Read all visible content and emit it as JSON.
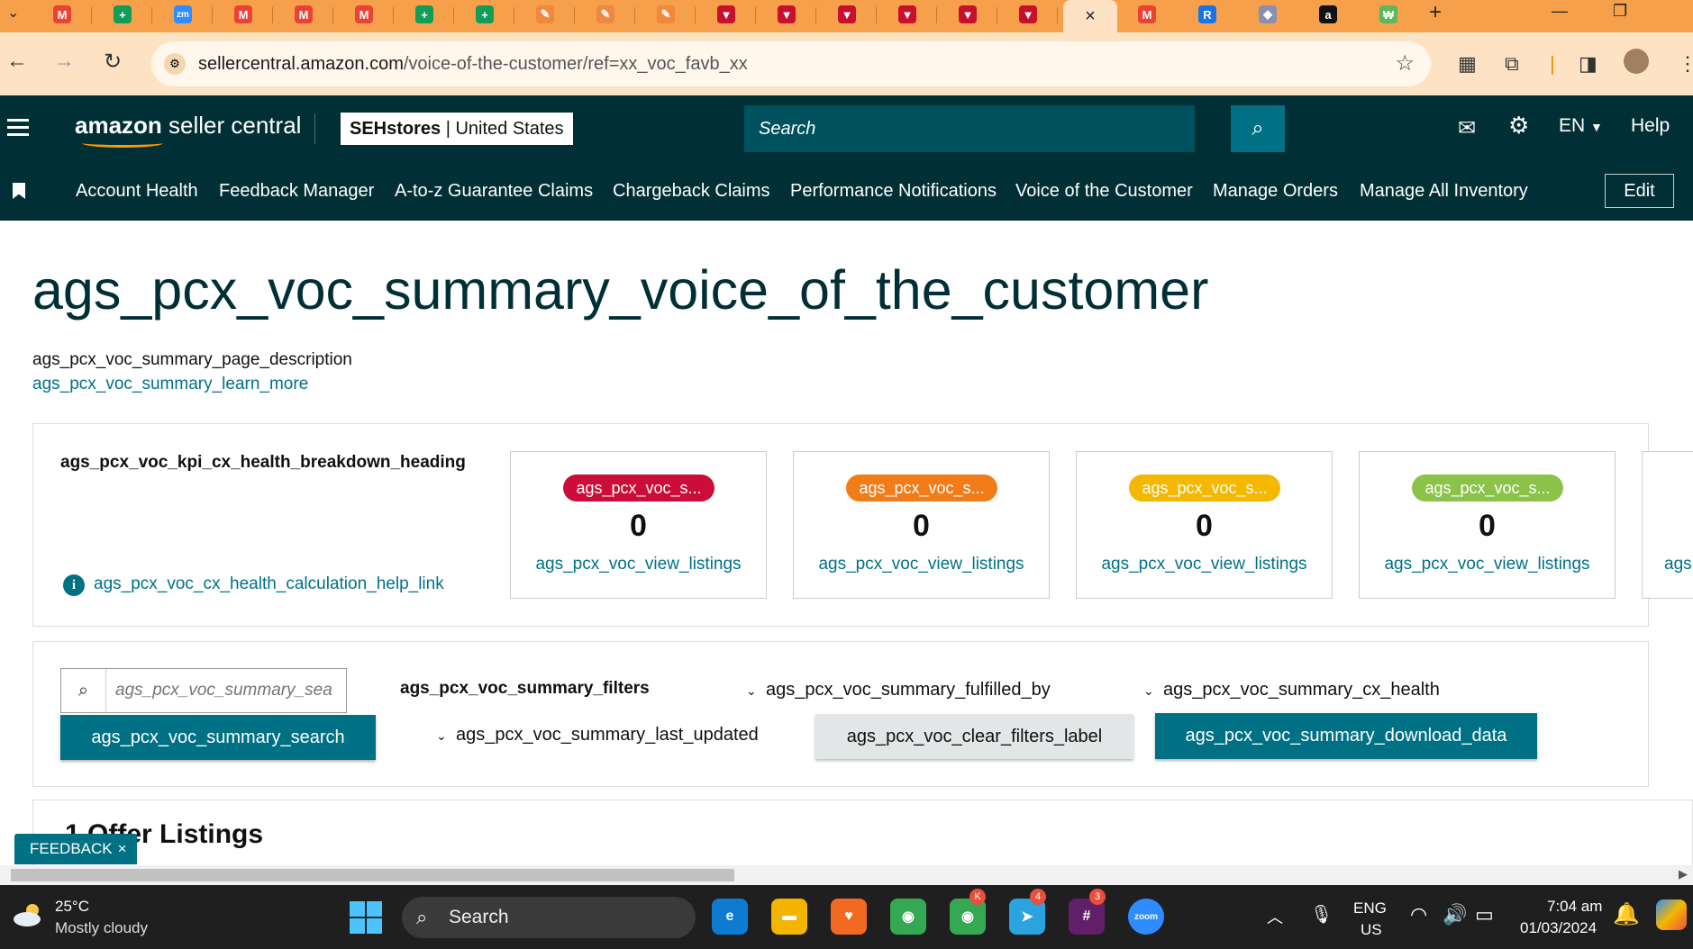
{
  "browser": {
    "tabs": [
      {
        "icon": "gmail-icon",
        "color": "#ea4335",
        "glyph": "M"
      },
      {
        "icon": "sheets-icon",
        "color": "#0f9d58",
        "glyph": "+"
      },
      {
        "icon": "zoom-icon",
        "color": "#2d8cff",
        "glyph": "zm"
      },
      {
        "icon": "gmail-icon",
        "color": "#ea4335",
        "glyph": "M"
      },
      {
        "icon": "gmail-icon",
        "color": "#ea4335",
        "glyph": "M"
      },
      {
        "icon": "gmail-icon",
        "color": "#ea4335",
        "glyph": "M"
      },
      {
        "icon": "sheets-icon",
        "color": "#0f9d58",
        "glyph": "+"
      },
      {
        "icon": "sheets-icon",
        "color": "#0f9d58",
        "glyph": "+"
      },
      {
        "icon": "edit-icon",
        "color": "#f0883e",
        "glyph": "✎"
      },
      {
        "icon": "edit-icon",
        "color": "#f0883e",
        "glyph": "✎"
      },
      {
        "icon": "edit-icon",
        "color": "#f0883e",
        "glyph": "✎"
      },
      {
        "icon": "vivaldi-icon",
        "color": "#c8102e",
        "glyph": "▼"
      },
      {
        "icon": "vivaldi-icon",
        "color": "#c8102e",
        "glyph": "▼"
      },
      {
        "icon": "vivaldi-icon",
        "color": "#c8102e",
        "glyph": "▼"
      },
      {
        "icon": "vivaldi-icon",
        "color": "#c8102e",
        "glyph": "▼"
      },
      {
        "icon": "vivaldi-icon",
        "color": "#c8102e",
        "glyph": "▼"
      },
      {
        "icon": "vivaldi-icon",
        "color": "#c8102e",
        "glyph": "▼"
      }
    ],
    "active_tab_close": "×",
    "after_tabs": [
      {
        "icon": "gmail-icon",
        "color": "#ea4335",
        "glyph": "M"
      },
      {
        "icon": "r-app-icon",
        "color": "#1a73e8",
        "glyph": "R"
      },
      {
        "icon": "puzzle-icon",
        "color": "#8a8fb0",
        "glyph": "◆"
      },
      {
        "icon": "amazon-icon",
        "color": "#111111",
        "glyph": "a"
      },
      {
        "icon": "green-app-icon",
        "color": "#5cb85c",
        "glyph": "₩"
      }
    ],
    "new_tab": "+",
    "url_domain": "sellercentral.amazon.com",
    "url_path": "/voice-of-the-customer/ref=xx_voc_favb_xx"
  },
  "header": {
    "logo_bold": "amazon",
    "logo_rest": " seller central",
    "store_name": "SEHstores",
    "store_sep": " | ",
    "store_region": "United States",
    "search_placeholder": "Search",
    "language": "EN",
    "help": "Help"
  },
  "nav": {
    "items": [
      "Account Health",
      "Feedback Manager",
      "A-to-z Guarantee Claims",
      "Chargeback Claims",
      "Performance Notifications",
      "Voice of the Customer",
      "Manage Orders",
      "Manage All Inventory"
    ],
    "edit": "Edit"
  },
  "page": {
    "title": "ags_pcx_voc_summary_voice_of_the_customer",
    "description": "ags_pcx_voc_summary_page_description",
    "learn_more": "ags_pcx_voc_summary_learn_more"
  },
  "kpi": {
    "heading": "ags_pcx_voc_kpi_cx_health_breakdown_heading",
    "help_link": "ags_pcx_voc_cx_health_calculation_help_link",
    "cards": [
      {
        "label": "ags_pcx_voc_s...",
        "count": "0",
        "link": "ags_pcx_voc_view_listings",
        "color": "#cc0c39"
      },
      {
        "label": "ags_pcx_voc_s...",
        "count": "0",
        "link": "ags_pcx_voc_view_listings",
        "color": "#f27c1a"
      },
      {
        "label": "ags_pcx_voc_s...",
        "count": "0",
        "link": "ags_pcx_voc_view_listings",
        "color": "#f5b800"
      },
      {
        "label": "ags_pcx_voc_s...",
        "count": "0",
        "link": "ags_pcx_voc_view_listings",
        "color": "#8bc34a"
      }
    ],
    "partial_link": "ags"
  },
  "filters": {
    "search_placeholder": "ags_pcx_voc_summary_sea",
    "search_button": "ags_pcx_voc_summary_search",
    "heading": "ags_pcx_voc_summary_filters",
    "fulfilled_by": "ags_pcx_voc_summary_fulfilled_by",
    "cx_health": "ags_pcx_voc_summary_cx_health",
    "last_updated": "ags_pcx_voc_summary_last_updated",
    "clear": "ags_pcx_voc_clear_filters_label",
    "download": "ags_pcx_voc_summary_download_data"
  },
  "listings": {
    "title": "1 Offer Listings"
  },
  "feedback": {
    "label": "FEEDBACK",
    "close": "×"
  },
  "taskbar": {
    "temperature": "25°C",
    "weather": "Mostly cloudy",
    "search": "Search",
    "apps": [
      {
        "icon": "edge-icon",
        "color": "#0c7bd1",
        "glyph": "e"
      },
      {
        "icon": "file-explorer-icon",
        "color": "#f4b400",
        "glyph": "▬"
      },
      {
        "icon": "brave-icon",
        "color": "#f26a21",
        "glyph": "♥"
      },
      {
        "icon": "chrome-icon",
        "color": "#34a853",
        "glyph": "◉"
      },
      {
        "icon": "chrome-icon",
        "color": "#34a853",
        "glyph": "◉"
      },
      {
        "icon": "telegram-icon",
        "color": "#2aa3de",
        "glyph": "➤"
      },
      {
        "icon": "slack-icon",
        "color": "#611f69",
        "glyph": "#"
      },
      {
        "icon": "zoom-icon",
        "color": "#2d8cff",
        "glyph": "zoom"
      }
    ],
    "badges": {
      "chrome2": "K",
      "telegram": "4",
      "slack": "3"
    },
    "lang_top": "ENG",
    "lang_bottom": "US",
    "time": "7:04 am",
    "date": "01/03/2024"
  }
}
